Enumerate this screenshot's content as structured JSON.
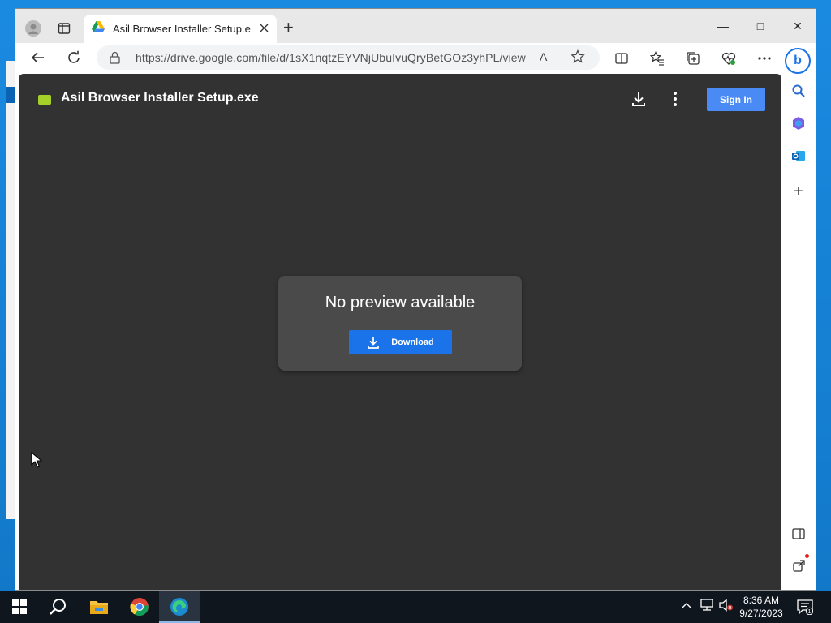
{
  "browser": {
    "tab": {
      "title": "Asil Browser Installer Setup.exe -"
    },
    "address": {
      "url": "https://drive.google.com/file/d/1sX1nqtzEYVNjUbuIvuQryBetGOz3yhPL/view"
    },
    "read_aloud_glyph": "A",
    "window_controls": {
      "minimize": "—",
      "maximize": "□",
      "close": "✕"
    },
    "new_tab_glyph": "+"
  },
  "drive": {
    "file_title": "Asil Browser Installer Setup.exe",
    "signin_label": "Sign In",
    "preview_message": "No preview available",
    "download_label": "Download"
  },
  "sidebar": {
    "bing_glyph": "b",
    "add_glyph": "+"
  },
  "taskbar": {
    "time": "8:36 AM",
    "date": "9/27/2023",
    "notification_count": "1"
  },
  "colors": {
    "desktop": "#1a8ae0",
    "drive_bg": "#323232",
    "preview_card": "#4a4a4a",
    "download_btn": "#1a73e8",
    "signin_btn": "#4a8af4",
    "taskbar": "#10161e"
  },
  "icons": [
    "profile-icon",
    "tab-actions-icon",
    "drive-favicon",
    "close-icon",
    "new-tab-icon",
    "back-icon",
    "refresh-icon",
    "lock-icon",
    "read-aloud-icon",
    "favorite-star-icon",
    "split-screen-icon",
    "favorites-icon",
    "collections-icon",
    "browser-essentials-icon",
    "more-icon",
    "bing-icon",
    "search-icon",
    "copilot-icon",
    "outlook-icon",
    "add-icon",
    "sidebar-toggle-icon",
    "open-external-icon",
    "settings-icon",
    "windows-start-icon",
    "search-taskbar-icon",
    "file-explorer-icon",
    "chrome-icon",
    "edge-icon",
    "chevron-up-icon",
    "network-icon",
    "volume-muted-icon",
    "notification-icon"
  ]
}
